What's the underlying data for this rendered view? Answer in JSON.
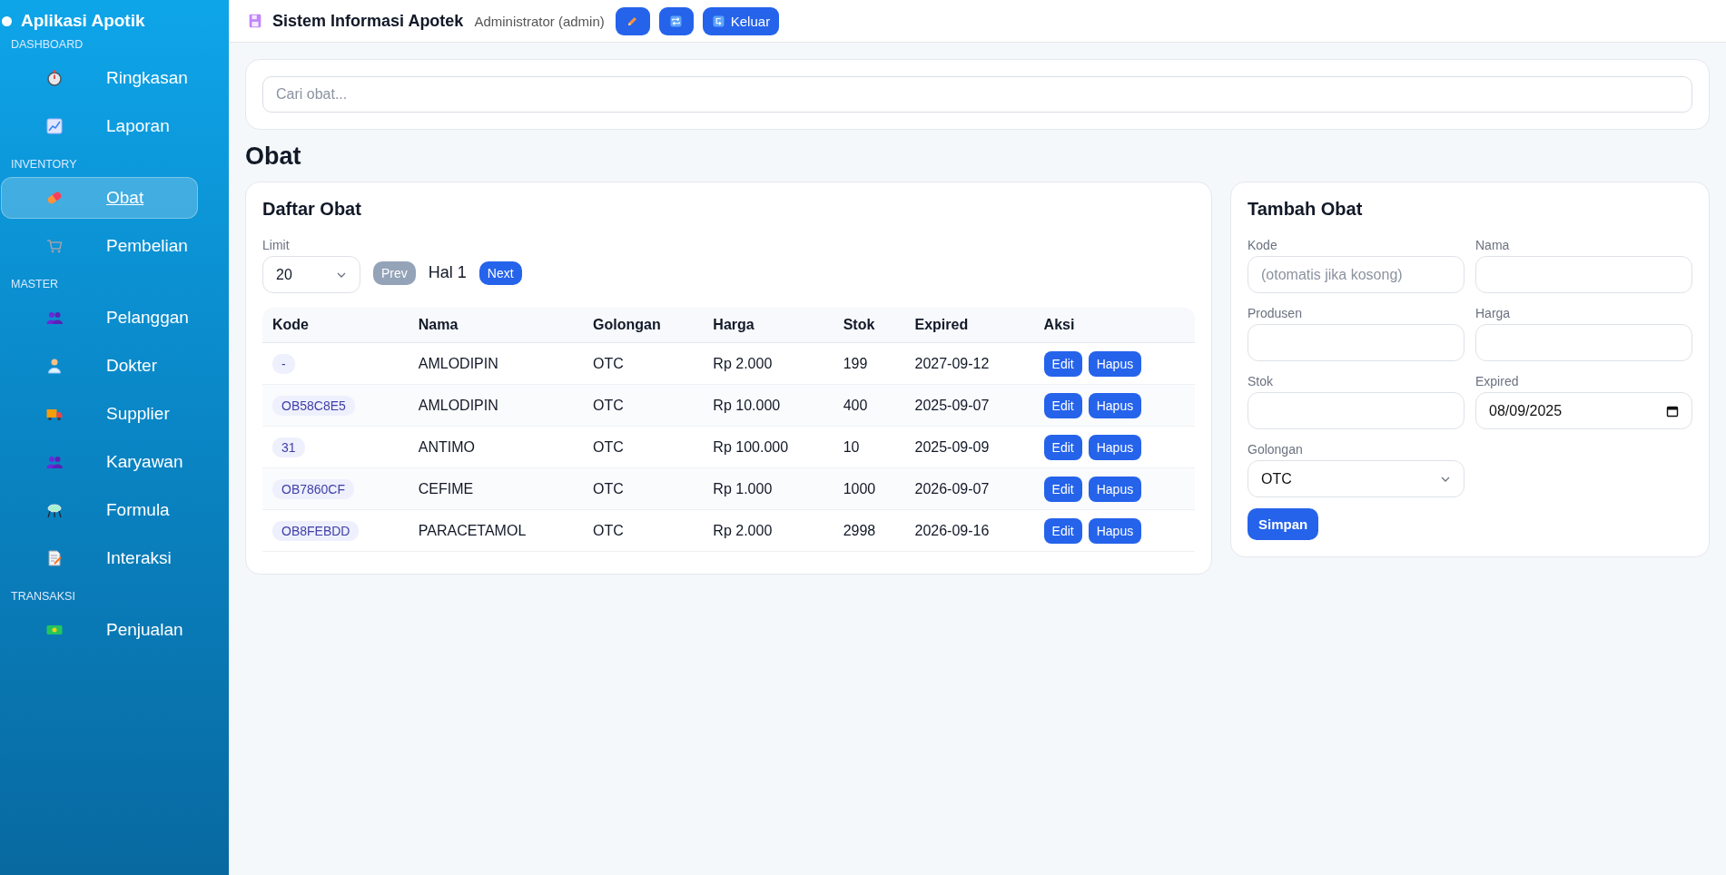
{
  "sidebar": {
    "title": "Aplikasi Apotik",
    "sections": [
      {
        "label": "DASHBOARD",
        "items": [
          {
            "label": "Ringkasan",
            "selected": false
          },
          {
            "label": "Laporan",
            "selected": false
          }
        ]
      },
      {
        "label": "INVENTORY",
        "items": [
          {
            "label": "Obat",
            "selected": true
          },
          {
            "label": "Pembelian",
            "selected": false
          }
        ]
      },
      {
        "label": "MASTER",
        "items": [
          {
            "label": "Pelanggan",
            "selected": false
          },
          {
            "label": "Dokter",
            "selected": false
          },
          {
            "label": "Supplier",
            "selected": false
          },
          {
            "label": "Karyawan",
            "selected": false
          },
          {
            "label": "Formula",
            "selected": false
          },
          {
            "label": "Interaksi",
            "selected": false
          }
        ]
      },
      {
        "label": "TRANSAKSI",
        "items": [
          {
            "label": "Penjualan",
            "selected": false
          }
        ]
      }
    ]
  },
  "header": {
    "title": "Sistem Informasi Apotek",
    "user": "Administrator (admin)",
    "logout": "Keluar"
  },
  "search": {
    "placeholder": "Cari obat..."
  },
  "page_title": "Obat",
  "list": {
    "title": "Daftar Obat",
    "limit_label": "Limit",
    "limit_value": "20",
    "prev": {
      "label": "Prev",
      "disabled": true
    },
    "page": "Hal 1",
    "next": {
      "label": "Next",
      "disabled": false
    },
    "columns": [
      "Kode",
      "Nama",
      "Golongan",
      "Harga",
      "Stok",
      "Expired",
      "Aksi"
    ],
    "rows": [
      {
        "kode": "-",
        "nama": "AMLODIPIN",
        "golongan": "OTC",
        "harga": "Rp 2.000",
        "stok": "199",
        "expired": "2027-09-12",
        "actions": [
          "Edit",
          "Hapus"
        ]
      },
      {
        "kode": "OB58C8E5",
        "nama": "AMLODIPIN",
        "golongan": "OTC",
        "harga": "Rp 10.000",
        "stok": "400",
        "expired": "2025-09-07",
        "actions": [
          "Edit",
          "Hapus"
        ]
      },
      {
        "kode": "31",
        "nama": "ANTIMO",
        "golongan": "OTC",
        "harga": "Rp 100.000",
        "stok": "10",
        "expired": "2025-09-09",
        "actions": [
          "Edit",
          "Hapus"
        ]
      },
      {
        "kode": "OB7860CF",
        "nama": "CEFIME",
        "golongan": "OTC",
        "harga": "Rp 1.000",
        "stok": "1000",
        "expired": "2026-09-07",
        "actions": [
          "Edit",
          "Hapus"
        ]
      },
      {
        "kode": "OB8FEBDD",
        "nama": "PARACETAMOL",
        "golongan": "OTC",
        "harga": "Rp 2.000",
        "stok": "2998",
        "expired": "2026-09-16",
        "actions": [
          "Edit",
          "Hapus"
        ]
      }
    ]
  },
  "form": {
    "title": "Tambah Obat",
    "fields": [
      {
        "kind": "text",
        "label": "Kode",
        "placeholder": "(otomatis jika kosong)"
      },
      {
        "kind": "text",
        "label": "Nama"
      },
      {
        "kind": "text",
        "label": "Produsen"
      },
      {
        "kind": "text",
        "label": "Harga"
      },
      {
        "kind": "text",
        "label": "Stok"
      },
      {
        "kind": "date",
        "label": "Expired",
        "value": "08/09/2025"
      },
      {
        "kind": "select",
        "label": "Golongan",
        "value": "OTC"
      }
    ],
    "submit": "Simpan"
  }
}
